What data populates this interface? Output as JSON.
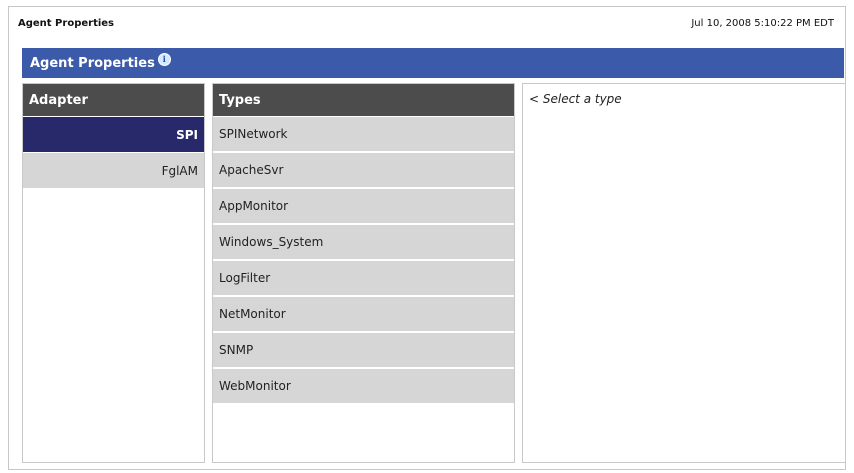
{
  "page": {
    "title": "Agent Properties",
    "timestamp": "Jul 10, 2008 5:10:22 PM EDT"
  },
  "panel": {
    "title": "Agent Properties",
    "info_icon": "info-icon"
  },
  "adapter": {
    "header": "Adapter",
    "items": [
      {
        "label": "SPI",
        "selected": true
      },
      {
        "label": "FglAM",
        "selected": false
      }
    ]
  },
  "types": {
    "header": "Types",
    "items": [
      {
        "label": "SPINetwork"
      },
      {
        "label": "ApacheSvr"
      },
      {
        "label": "AppMonitor"
      },
      {
        "label": "Windows_System"
      },
      {
        "label": "LogFilter"
      },
      {
        "label": "NetMonitor"
      },
      {
        "label": "SNMP"
      },
      {
        "label": "WebMonitor"
      }
    ]
  },
  "detail": {
    "hint": "< Select a type"
  },
  "colors": {
    "panel_header": "#3b5aa9",
    "column_header": "#4c4c4c",
    "selected_item": "#27296b",
    "item_background": "#d6d6d6"
  }
}
